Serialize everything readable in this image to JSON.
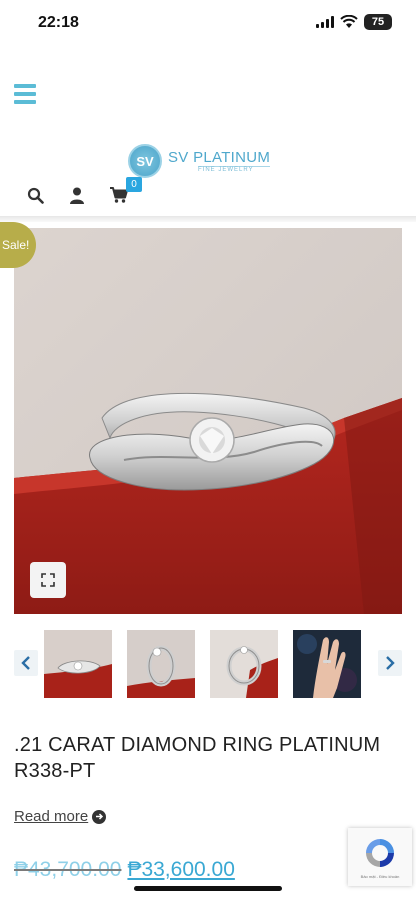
{
  "status_bar": {
    "time": "22:18",
    "battery": "75",
    "icons": [
      "signal-icon",
      "wifi-icon",
      "battery-icon"
    ]
  },
  "header": {
    "menu_icon": "hamburger-menu-icon",
    "logo": {
      "badge": "SV",
      "name": "SV PLATINUM",
      "tagline": "FINE JEWELRY"
    },
    "icons": [
      "search-icon",
      "account-icon",
      "cart-icon"
    ],
    "cart_count": "0"
  },
  "product": {
    "sale_badge": "Sale!",
    "zoom_icon": "fullscreen-icon",
    "thumbnails": [
      {
        "name": "thumbnail-ring-side"
      },
      {
        "name": "thumbnail-ring-angle"
      },
      {
        "name": "thumbnail-ring-front"
      },
      {
        "name": "thumbnail-ring-on-hand"
      }
    ],
    "title": ".21 CARAT DIAMOND RING PLATINUM R338-PT",
    "read_more": "Read more",
    "price_old": "₱43,700.00",
    "price_new": "₱33,600.00"
  },
  "recaptcha": {
    "text": "Bảo mật - Điều khoản"
  },
  "colors": {
    "accent": "#5bbcd6",
    "price": "#3aa8d3",
    "sale_badge": "#b7ad4a",
    "cart_badge": "#2aa6e0"
  }
}
